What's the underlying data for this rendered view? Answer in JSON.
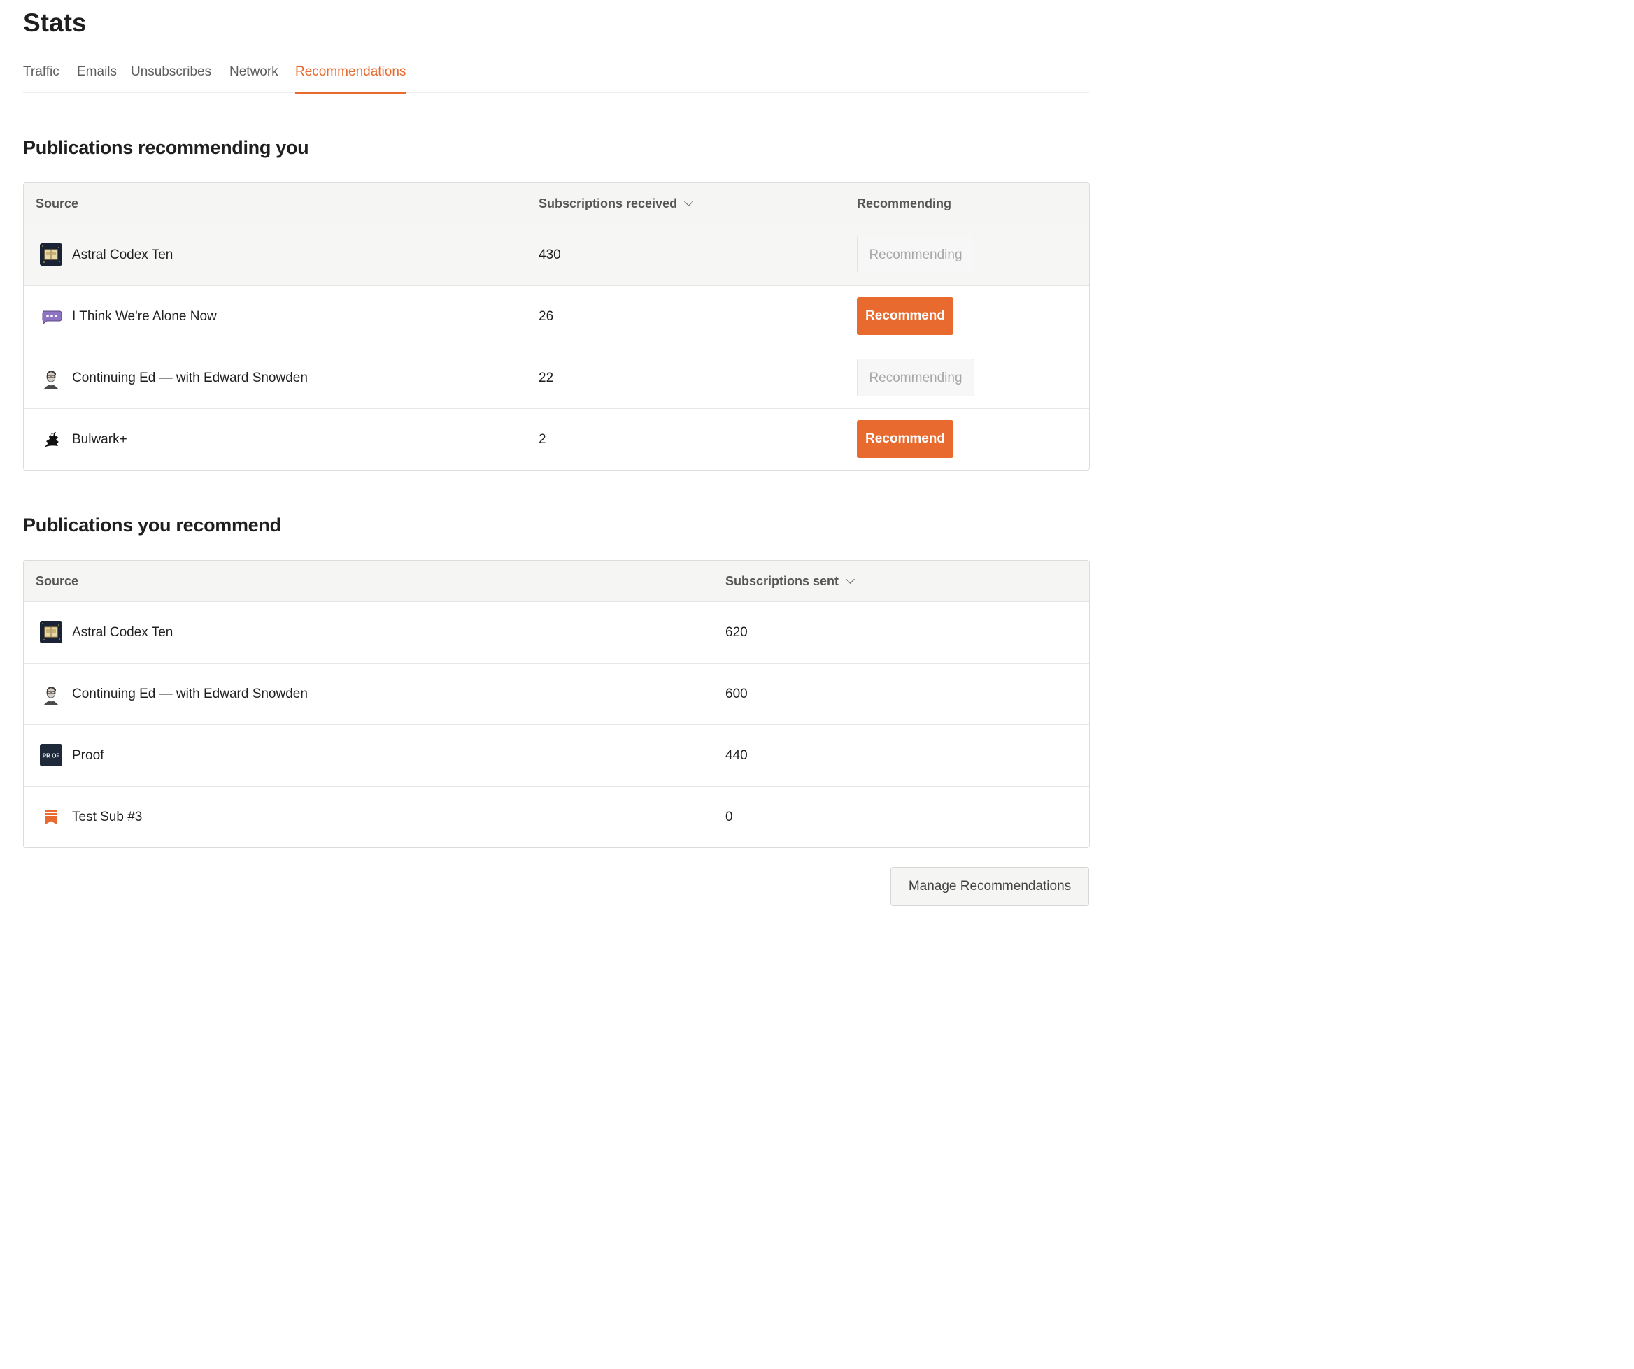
{
  "page": {
    "title": "Stats"
  },
  "tabs": [
    {
      "label": "Traffic",
      "active": false
    },
    {
      "label": "Emails",
      "active": false
    },
    {
      "label": "Unsubscribes",
      "active": false
    },
    {
      "label": "Network",
      "active": false
    },
    {
      "label": "Recommendations",
      "active": true
    }
  ],
  "accent_color": "#e86a2f",
  "recommending_you": {
    "title": "Publications recommending you",
    "headers": {
      "source": "Source",
      "count": "Subscriptions received",
      "status": "Recommending"
    },
    "rows": [
      {
        "name": "Astral Codex Ten",
        "icon": "astral-codex-ten-logo",
        "count": "430",
        "action": "Recommending",
        "action_type": "ghost"
      },
      {
        "name": "I Think We're Alone Now",
        "icon": "speech-bubble-logo",
        "count": "26",
        "action": "Recommend",
        "action_type": "primary"
      },
      {
        "name": "Continuing Ed — with Edward Snowden",
        "icon": "portrait-logo",
        "count": "22",
        "action": "Recommending",
        "action_type": "ghost"
      },
      {
        "name": "Bulwark+",
        "icon": "ship-logo",
        "count": "2",
        "action": "Recommend",
        "action_type": "primary"
      }
    ]
  },
  "you_recommend": {
    "title": "Publications you recommend",
    "headers": {
      "source": "Source",
      "count": "Subscriptions sent"
    },
    "rows": [
      {
        "name": "Astral Codex Ten",
        "icon": "astral-codex-ten-logo",
        "count": "620"
      },
      {
        "name": "Continuing Ed — with Edward Snowden",
        "icon": "portrait-logo",
        "count": "600"
      },
      {
        "name": "Proof",
        "icon": "proof-logo",
        "logo_text": "PR OF",
        "count": "440"
      },
      {
        "name": "Test Sub #3",
        "icon": "substack-bookmark-logo",
        "count": "0"
      }
    ]
  },
  "manage_button": "Manage Recommendations"
}
